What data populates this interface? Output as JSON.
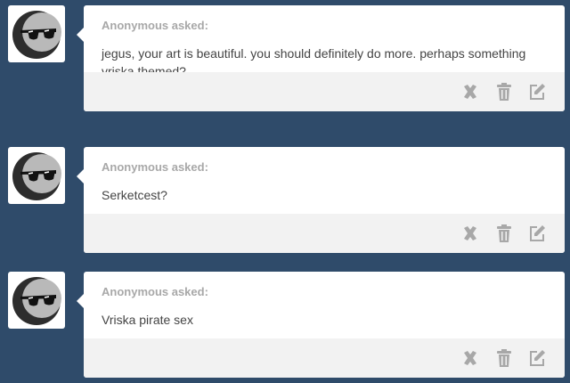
{
  "posts": [
    {
      "asker": "Anonymous asked:",
      "question": "jegus, your art is beautiful. you should definitely do more. perhaps something vriska themed?"
    },
    {
      "asker": "Anonymous asked:",
      "question": "Serketcest?"
    },
    {
      "asker": "Anonymous asked:",
      "question": "Vriska pirate sex"
    }
  ],
  "icons": {
    "avatar": "anonymous-sunglasses-avatar",
    "delete": "x-icon",
    "trash": "trash-icon",
    "edit": "edit-icon"
  },
  "colors": {
    "background": "#2f4b6a",
    "card": "#ffffff",
    "footer": "#f2f2f2",
    "asker_text": "#a8a8a8",
    "question_text": "#444444",
    "icon": "#a8a8a8"
  }
}
